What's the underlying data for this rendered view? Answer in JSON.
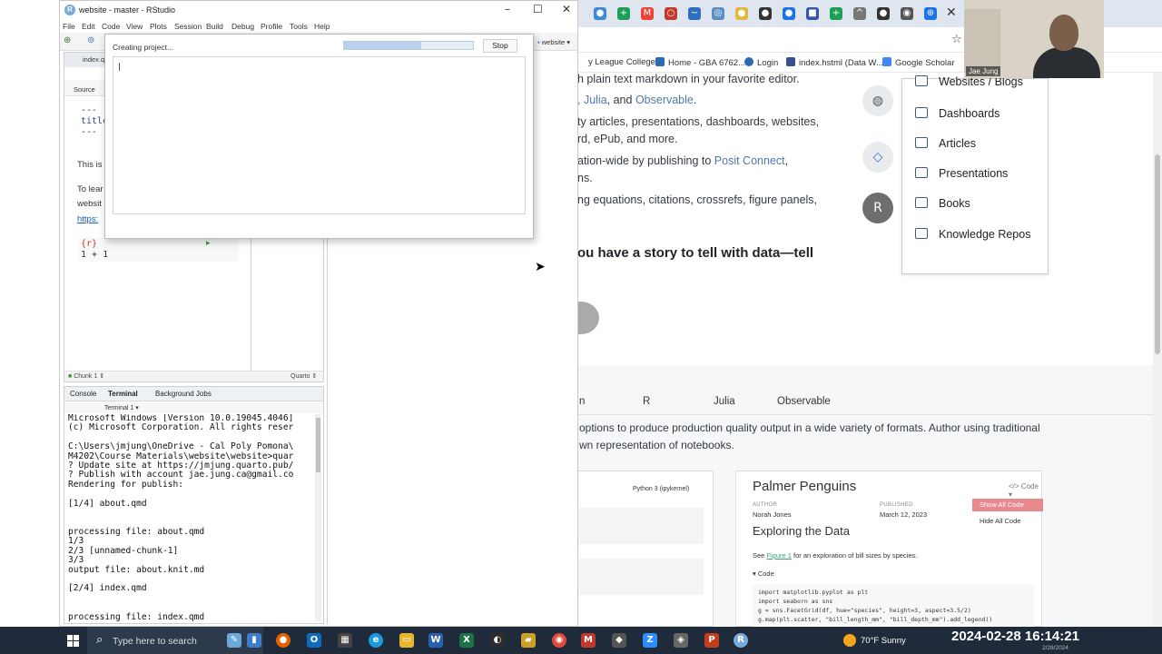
{
  "rstudio": {
    "window_title": "website - master - RStudio",
    "menu": [
      "File",
      "Edit",
      "Code",
      "View",
      "Plots",
      "Session",
      "Build",
      "Debug",
      "Profile",
      "Tools",
      "Help"
    ],
    "project_label": "website",
    "source_tab": "index.qm",
    "source_mode": "Source",
    "code": {
      "line1": "---",
      "line2_key": "title",
      "line3": "---",
      "md1": "This is",
      "md2": "To lear",
      "md3": "websit",
      "md4": "https:",
      "chunk_header": "{r}",
      "chunk_code": "1 + 1"
    },
    "status": {
      "chunk": "Chunk 1",
      "type": "Quarto"
    },
    "console_tabs": [
      "Console",
      "Terminal",
      "Background Jobs"
    ],
    "terminal_label": "Terminal 1",
    "console_lines": [
      "Microsoft Windows [Version 10.0.19045.4046]",
      "(c) Microsoft Corporation. All rights reser",
      "",
      "C:\\Users\\jmjung\\OneDrive - Cal Poly Pomona\\",
      "M4202\\Course Materials\\website\\website>quar",
      "? Update site at https://jmjung.quarto.pub/",
      "? Publish with account jae.jung.ca@gmail.co",
      "Rendering for publish:",
      "",
      "[1/4] about.qmd",
      "",
      "",
      "processing file: about.qmd",
      "1/3",
      "2/3 [unnamed-chunk-1]",
      "3/3",
      "output file: about.knit.md",
      "",
      "[2/4] index.qmd",
      "",
      "",
      "processing file: index.qmd"
    ],
    "dialog": {
      "title": "Creating project...",
      "stop_label": "Stop",
      "progress": 0.6
    }
  },
  "browser": {
    "bookmarks": [
      "y League College...",
      "Home - GBA 6762...",
      "Login",
      "index.hstml (Data W...",
      "Google Scholar"
    ],
    "hero_lines": [
      {
        "text": "h plain text markdown in your favorite editor."
      },
      {
        "text": "",
        "links": [
          ", Julia",
          ", and ",
          "Observable",
          "."
        ]
      },
      {
        "text": "ty articles, presentations, dashboards, websites,"
      },
      {
        "text": "rd, ePub, and more."
      },
      {
        "text": "ation-wide by publishing to ",
        "link": "Posit Connect",
        "after": ","
      },
      {
        "text": "ns."
      },
      {
        "text": "ng equations, citations, crossrefs, figure panels,"
      }
    ],
    "tagline": "ou have a story to tell with data—tell",
    "menu_items": [
      "Websites / Blogs",
      "Dashboards",
      "Articles",
      "Presentations",
      "Books",
      "Knowledge Repos"
    ],
    "lang_tabs": [
      "n",
      "R",
      "Julia",
      "Observable"
    ],
    "band_text_1": "options to produce production quality output in a wide variety of formats. Author using traditional",
    "band_text_2": "wn representation of notebooks.",
    "kernel": "Python 3 (ipykernel)",
    "preview": {
      "title": "Palmer Penguins",
      "code_btn": "</> Code ▾",
      "author_label": "AUTHOR",
      "author": "Norah Jones",
      "published_label": "PUBLISHED",
      "published": "March 12, 2023",
      "show_all": "Show All Code",
      "hide_all": "Hide All Code",
      "heading": "Exploring the Data",
      "see_prefix": "See ",
      "see_link": "Figure 1",
      "see_suffix": " for an exploration of bill sizes by species.",
      "code_toggle": "▾ Code",
      "code_lines": [
        "import matplotlib.pyplot as plt",
        "import seaborn as sns",
        "g = sns.FacetGrid(df, hue=\"species\", height=3, aspect=3.5/2)",
        "g.map(plt.scatter, \"bill_length_mm\", \"bill_depth_mm\").add_legend()"
      ]
    }
  },
  "webcam": {
    "name": "Jae Jung"
  },
  "taskbar": {
    "search_placeholder": "Type here to search",
    "weather": "70°F  Sunny",
    "datetime": "2024-02-28  16:14:21",
    "date_small": "2/28/2024"
  },
  "colors": {
    "rstudio_blue": "#75aadb",
    "taskbar": "#1f2b3a",
    "link": "#4d79a8"
  }
}
